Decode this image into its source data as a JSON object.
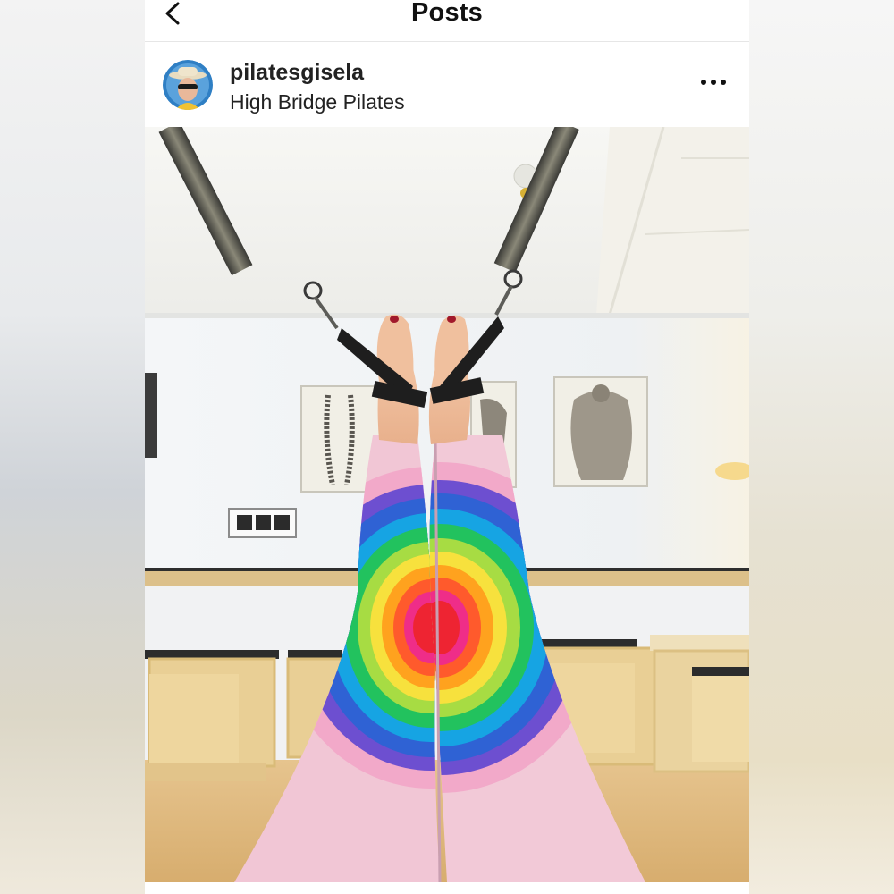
{
  "header": {
    "title": "Posts",
    "back_icon": "chevron-left-icon"
  },
  "post": {
    "username": "pilatesgisela",
    "location": "High Bridge Pilates",
    "more_icon": "more-horizontal-icon",
    "avatar_icon": "avatar"
  },
  "colors": {
    "background": "#ffffff",
    "text": "#111111",
    "divider": "#e6e6e6"
  }
}
